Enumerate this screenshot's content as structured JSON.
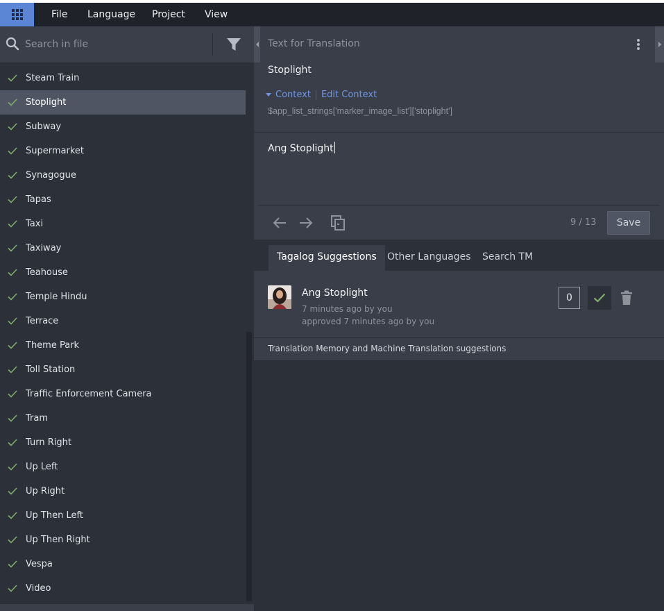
{
  "menu": {
    "apps_icon": "grid-icon",
    "items": [
      "File",
      "Language",
      "Project",
      "View"
    ]
  },
  "sidebar": {
    "search_placeholder": "Search in file",
    "search_icon": "search-icon",
    "filter_icon": "filter-icon",
    "items": [
      {
        "label": "Steam Train"
      },
      {
        "label": "Stoplight",
        "selected": true
      },
      {
        "label": "Subway"
      },
      {
        "label": "Supermarket"
      },
      {
        "label": "Synagogue"
      },
      {
        "label": "Tapas"
      },
      {
        "label": "Taxi"
      },
      {
        "label": "Taxiway"
      },
      {
        "label": "Teahouse"
      },
      {
        "label": "Temple Hindu"
      },
      {
        "label": "Terrace"
      },
      {
        "label": "Theme Park"
      },
      {
        "label": "Toll Station"
      },
      {
        "label": "Traffic Enforcement Camera"
      },
      {
        "label": "Tram"
      },
      {
        "label": "Turn Right"
      },
      {
        "label": "Up Left"
      },
      {
        "label": "Up Right"
      },
      {
        "label": "Up Then Left"
      },
      {
        "label": "Up Then Right"
      },
      {
        "label": "Vespa"
      },
      {
        "label": "Video"
      }
    ]
  },
  "editor": {
    "source_header": "Text for Translation",
    "source_text": "Stoplight",
    "context_toggle": "Context",
    "edit_context": "Edit Context",
    "context_key": "$app_list_strings['marker_image_list']['stoplight']",
    "translation_value": "Ang Stoplight",
    "counter": "9 / 13",
    "save_label": "Save"
  },
  "tabs": [
    {
      "label": "Tagalog Suggestions",
      "active": true
    },
    {
      "label": "Other Languages"
    },
    {
      "label": "Search TM"
    }
  ],
  "suggestion": {
    "text": "Ang Stoplight",
    "meta_created": "7 minutes ago by you",
    "meta_approved": "approved 7 minutes ago by you",
    "votes": "0"
  },
  "tm_label": "Translation Memory and Machine Translation suggestions",
  "colors": {
    "accent": "#5b86d6",
    "link": "#6f95e6",
    "check_green": "#7fae6b",
    "selected_row": "#4f5563"
  }
}
